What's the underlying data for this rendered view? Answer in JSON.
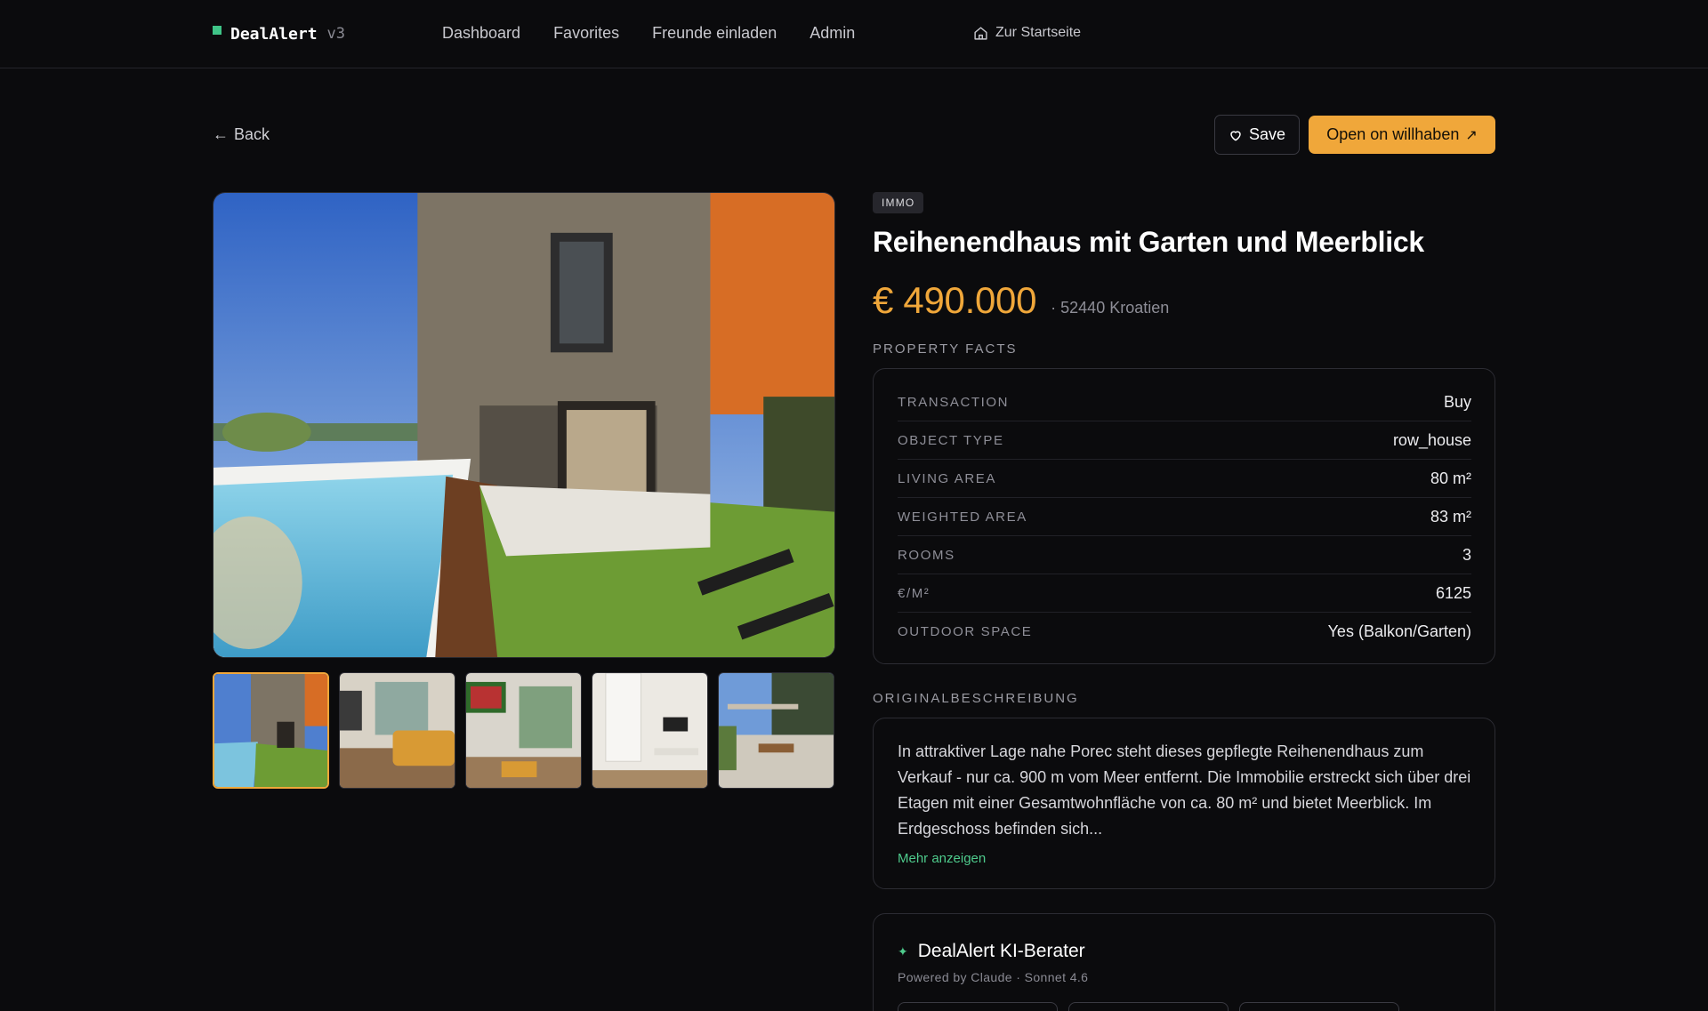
{
  "brand": {
    "name": "DealAlert",
    "version": "v3"
  },
  "nav": {
    "links": [
      "Dashboard",
      "Favorites",
      "Freunde einladen",
      "Admin"
    ],
    "home_label": "Zur Startseite"
  },
  "actions": {
    "back_label": "Back",
    "save_label": "Save",
    "open_label": "Open on willhaben",
    "open_icon": "external-arrow-icon"
  },
  "listing": {
    "category": "IMMO",
    "title": "Reihenendhaus mit Garten und Meerblick",
    "price": "€ 490.000",
    "location": "· 52440 Kroatien",
    "gallery": {
      "main": "pool-garden-exterior",
      "thumbnails": [
        "pool-garden-exterior",
        "living-room-yellow-sofa",
        "tv-living-area",
        "white-bedroom",
        "garden-pergola"
      ],
      "active_index": 0
    }
  },
  "facts": {
    "label": "PROPERTY FACTS",
    "rows": [
      {
        "k": "TRANSACTION",
        "v": "Buy"
      },
      {
        "k": "OBJECT TYPE",
        "v": "row_house"
      },
      {
        "k": "LIVING AREA",
        "v": "80 m²"
      },
      {
        "k": "WEIGHTED AREA",
        "v": "83 m²"
      },
      {
        "k": "ROOMS",
        "v": "3"
      },
      {
        "k": "€/M²",
        "v": "6125"
      },
      {
        "k": "OUTDOOR SPACE",
        "v": "Yes (Balkon/Garten)"
      }
    ]
  },
  "description": {
    "label": "ORIGINALBESCHREIBUNG",
    "text": "In attraktiver Lage nahe Porec steht dieses gepflegte Reihenendhaus zum Verkauf - nur ca. 900 m vom Meer entfernt. Die Immobilie erstreckt sich über drei Etagen mit einer Gesamtwohnfläche von ca. 80 m² und bietet Meerblick. Im Erdgeschoss befinden sich...",
    "more_label": "Mehr anzeigen"
  },
  "advisor": {
    "title": "DealAlert KI-Berater",
    "subtitle": "Powered by Claude · Sonnet 4.6"
  },
  "colors": {
    "accent": "#f0a73a",
    "brand_green": "#3fc487",
    "link_green": "#4ecb8c",
    "background": "#0b0b0d"
  }
}
